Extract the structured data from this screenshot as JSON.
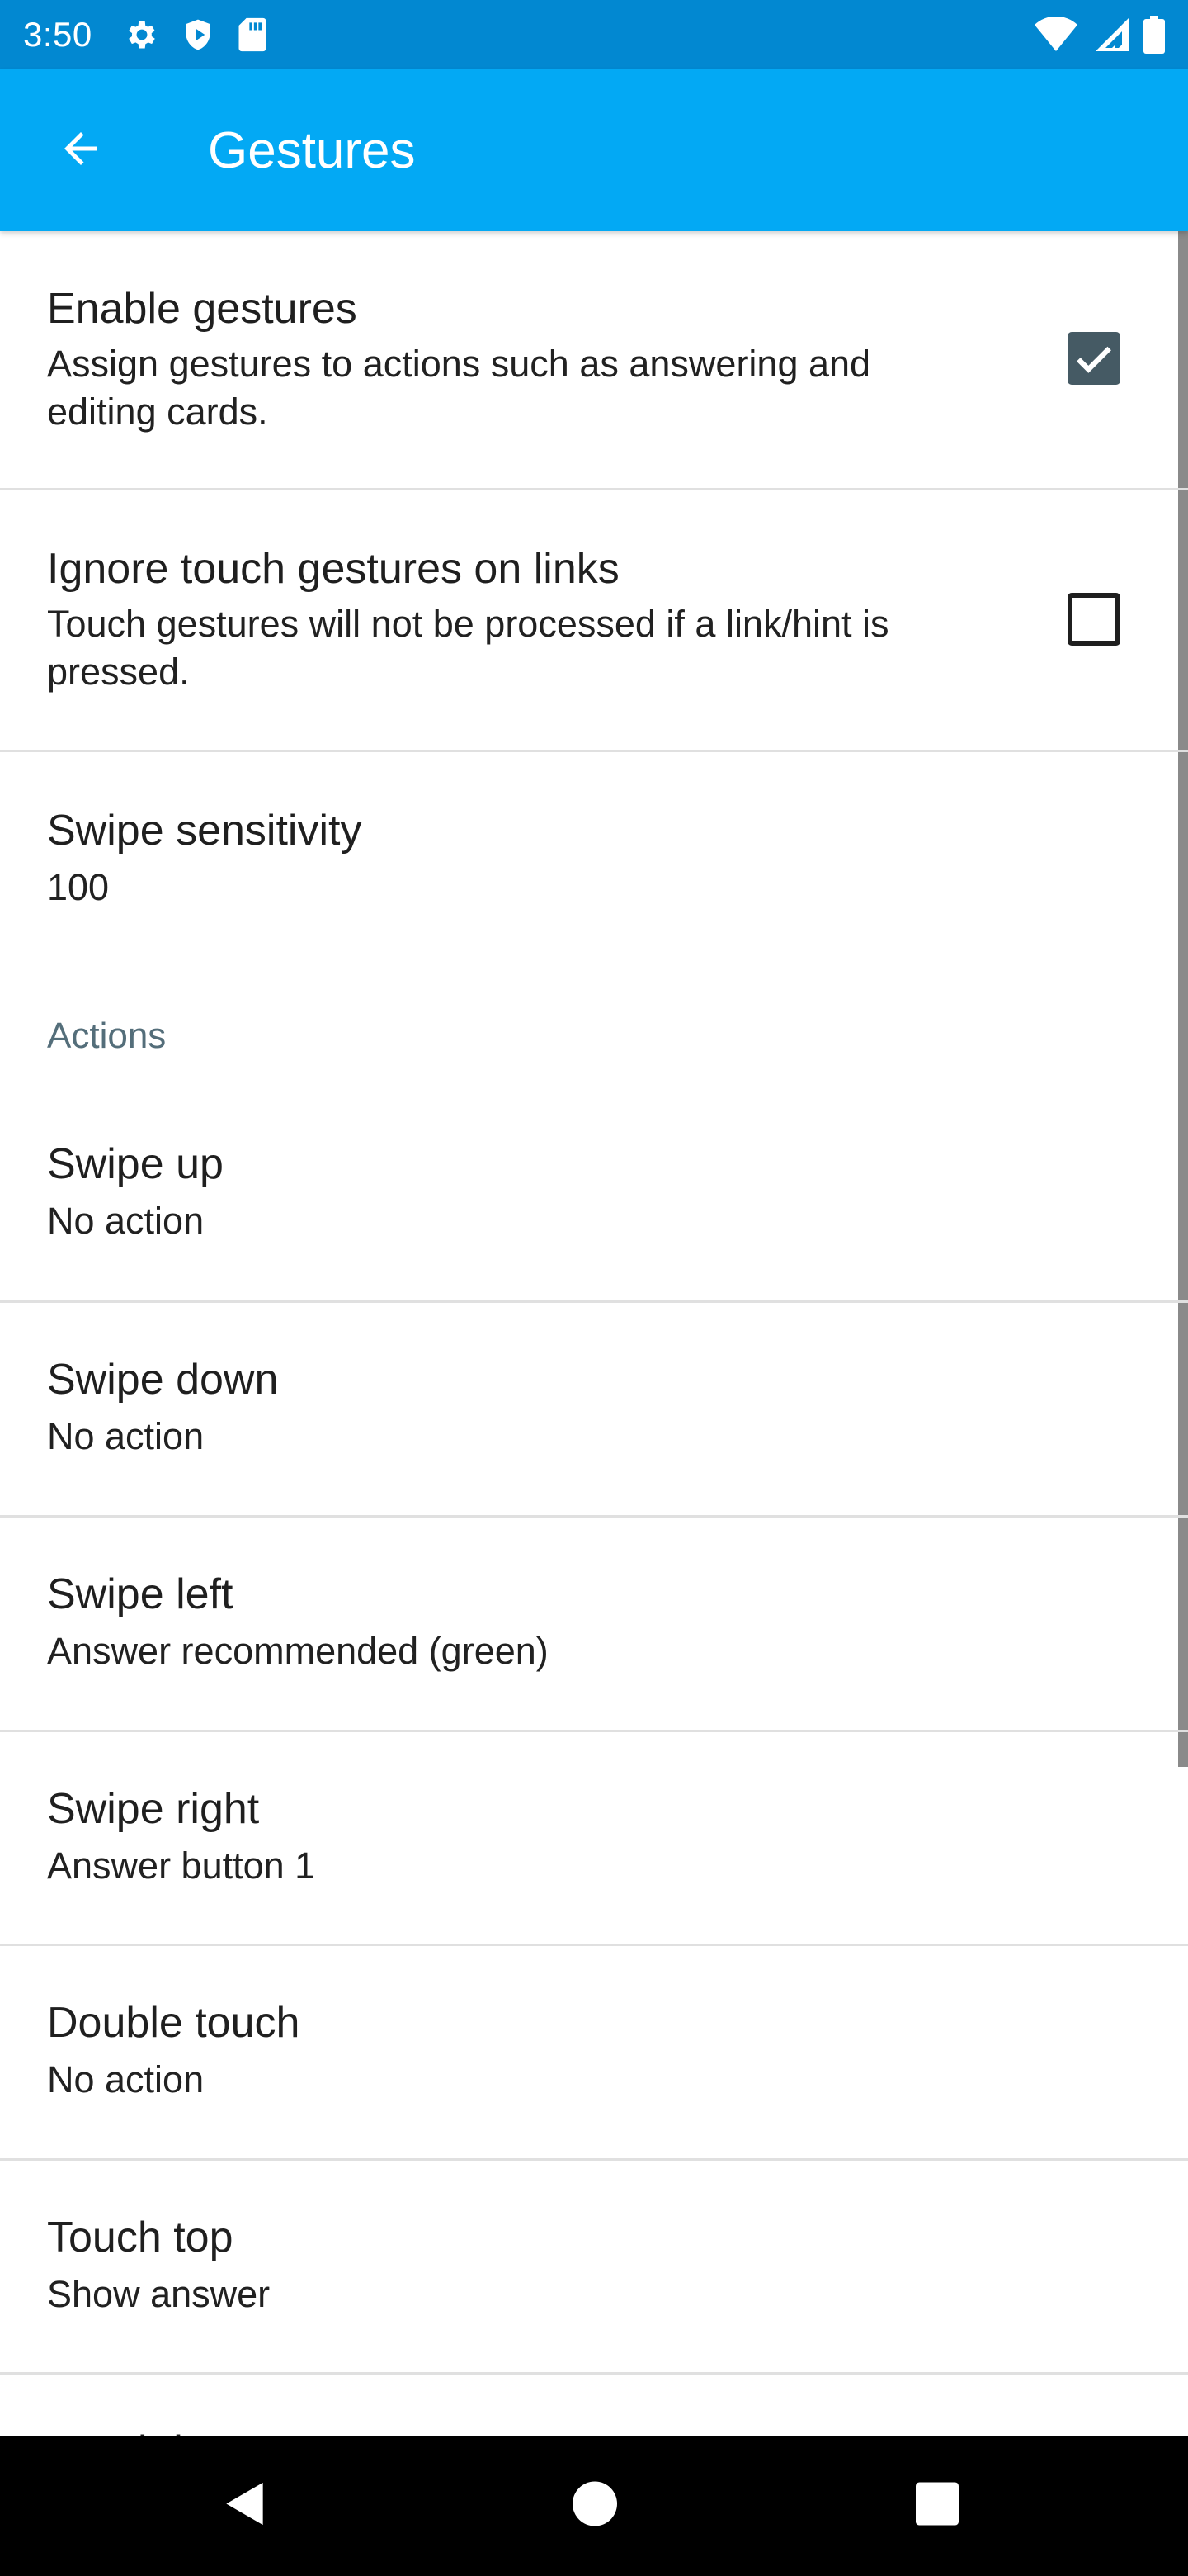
{
  "status_bar": {
    "time": "3:50",
    "icons_left": [
      "gear-icon",
      "shield-icon",
      "sd-card-icon"
    ],
    "icons_right": [
      "wifi-icon",
      "cell-signal-icon",
      "battery-icon"
    ],
    "background": "#0288d1"
  },
  "app_bar": {
    "title": "Gestures",
    "back_icon": "arrow-back-icon",
    "background": "#03a9f4"
  },
  "preferences": {
    "enable_gestures": {
      "title": "Enable gestures",
      "summary": "Assign gestures to actions such as answering and editing cards.",
      "checked": true
    },
    "ignore_links": {
      "title": "Ignore touch gestures on links",
      "summary": "Touch gestures will not be processed if a link/hint is pressed.",
      "checked": false
    },
    "swipe_sensitivity": {
      "title": "Swipe sensitivity",
      "value": "100"
    }
  },
  "actions": {
    "category": "Actions",
    "items": [
      {
        "title": "Swipe up",
        "value": "No action"
      },
      {
        "title": "Swipe down",
        "value": "No action"
      },
      {
        "title": "Swipe left",
        "value": "Answer recommended (green)"
      },
      {
        "title": "Swipe right",
        "value": "Answer button 1"
      },
      {
        "title": "Double touch",
        "value": "No action"
      },
      {
        "title": "Touch top",
        "value": "Show answer"
      },
      {
        "title": "Touch bottom",
        "value": ""
      }
    ]
  },
  "nav_bar": {
    "buttons": [
      "back-triangle-icon",
      "home-circle-icon",
      "recents-square-icon"
    ]
  },
  "colors": {
    "checkbox_checked": "#455a64",
    "category": "#546e7a",
    "divider": "#e0e0e0"
  }
}
